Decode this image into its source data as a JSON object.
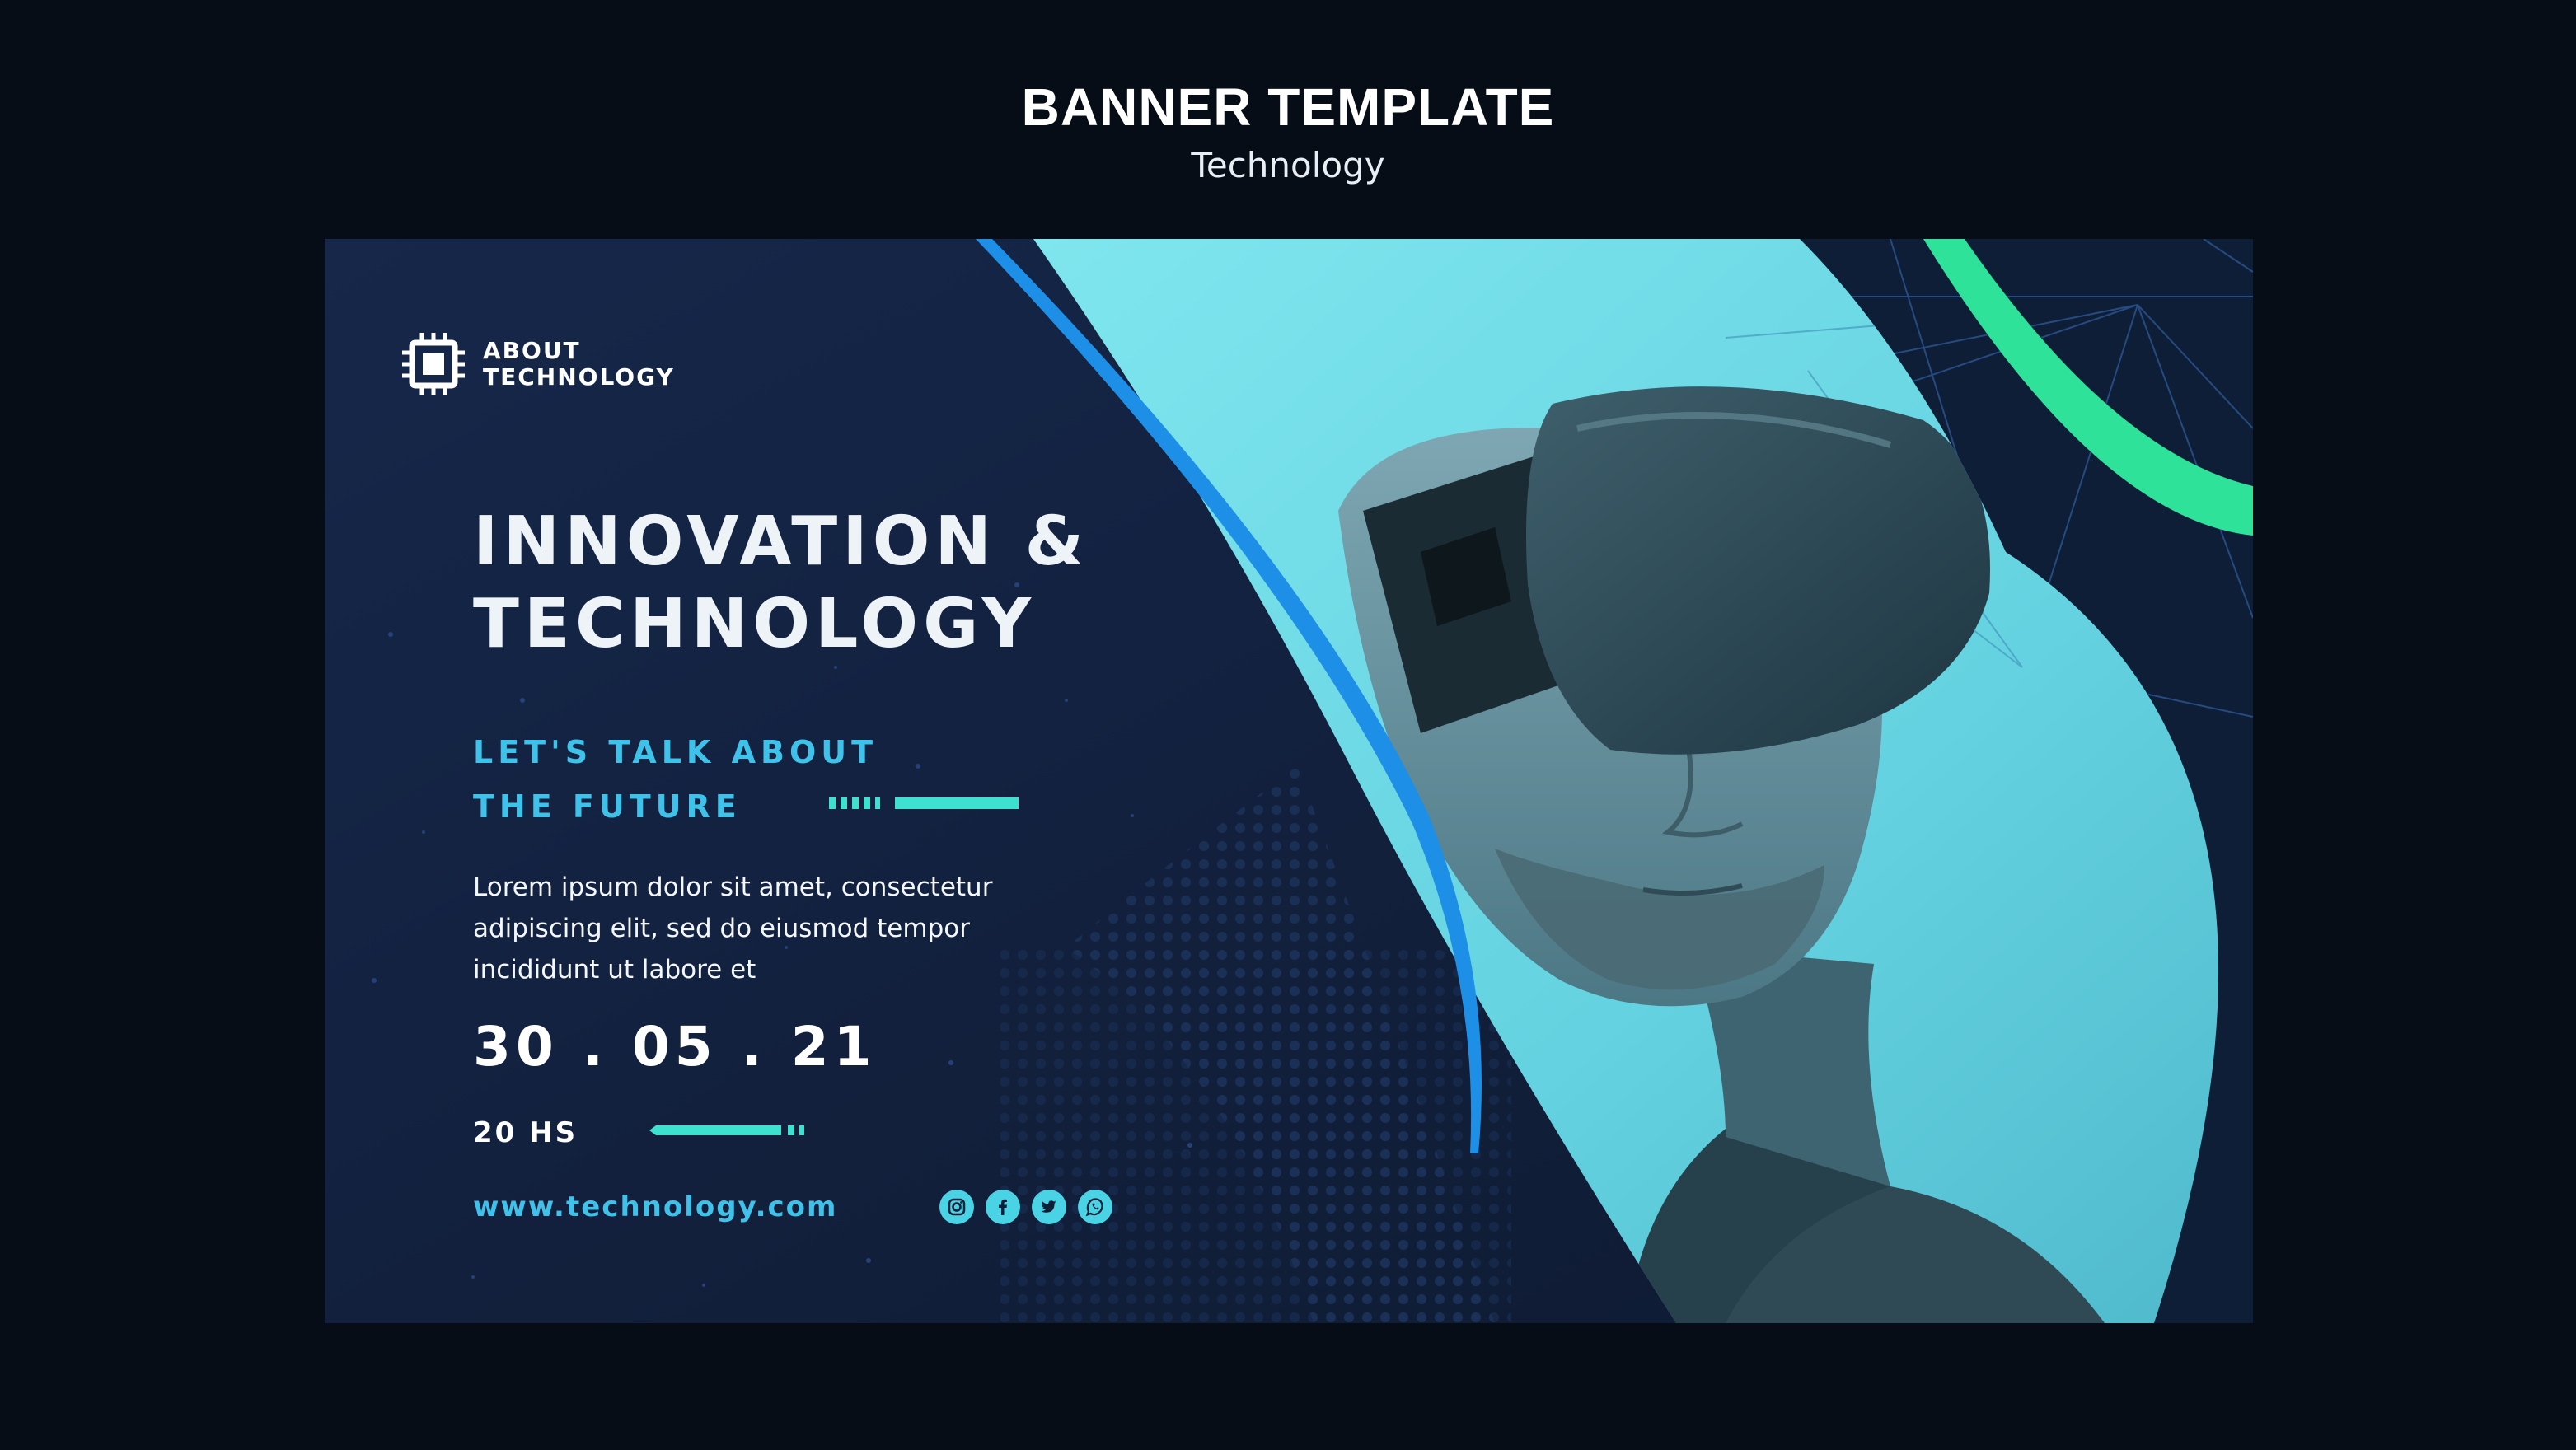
{
  "page": {
    "title": "BANNER TEMPLATE",
    "subtitle": "Technology"
  },
  "banner": {
    "logo": {
      "line1": "ABOUT",
      "line2": "TECHNOLOGY",
      "icon": "chip-icon"
    },
    "headline": {
      "line1": "INNOVATION &",
      "line2": "TECHNOLOGY"
    },
    "tagline": {
      "line1": "LET'S TALK ABOUT",
      "line2": "THE FUTURE"
    },
    "body": "Lorem ipsum dolor sit amet, consectetur adipiscing elit, sed do eiusmod tempor incididunt ut labore et",
    "date": "30 . 05 . 21",
    "time": "20 HS",
    "website": "www.technology.com",
    "socials": [
      "instagram-icon",
      "facebook-icon",
      "twitter-icon",
      "whatsapp-icon"
    ],
    "colors": {
      "background": "#060d16",
      "panel": "#122038",
      "accent_cyan": "#3fc2ea",
      "accent_teal": "#3ee0cf",
      "accent_green": "#2fe29a",
      "photo_tone": "#6fd9e4"
    }
  }
}
